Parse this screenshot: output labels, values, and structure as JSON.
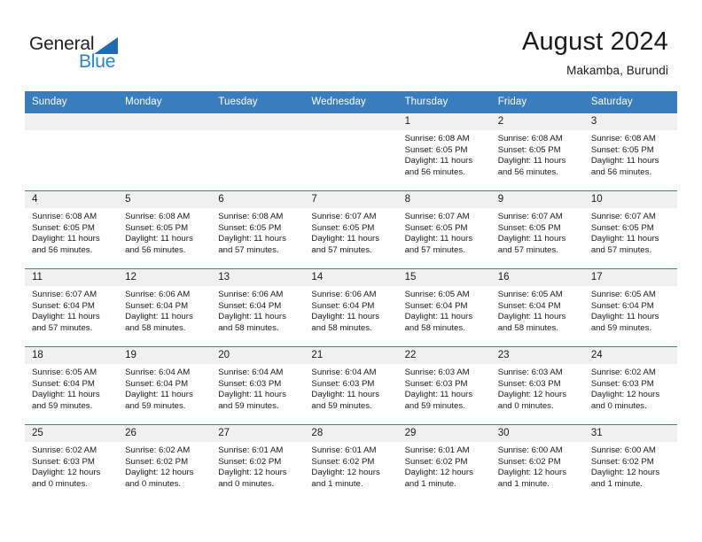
{
  "brand": {
    "name_part1": "General",
    "name_part2": "Blue",
    "triangle_color": "#1f6cb4",
    "blue_color": "#2684c8"
  },
  "header": {
    "title": "August 2024",
    "subtitle": "Makamba, Burundi"
  },
  "theme": {
    "header_row_bg": "#3a7dbf",
    "daynum_band_bg": "#f0f0f0",
    "cell_border": "#3a7dbf",
    "text": "#1a1a1a"
  },
  "weekday_headers": [
    "Sunday",
    "Monday",
    "Tuesday",
    "Wednesday",
    "Thursday",
    "Friday",
    "Saturday"
  ],
  "labels": {
    "sunrise_prefix": "Sunrise: ",
    "sunset_prefix": "Sunset: ",
    "daylight_prefix": "Daylight: "
  },
  "weeks": [
    [
      {
        "day": "",
        "sunrise": "",
        "sunset": "",
        "daylight": "",
        "empty": true
      },
      {
        "day": "",
        "sunrise": "",
        "sunset": "",
        "daylight": "",
        "empty": true
      },
      {
        "day": "",
        "sunrise": "",
        "sunset": "",
        "daylight": "",
        "empty": true
      },
      {
        "day": "",
        "sunrise": "",
        "sunset": "",
        "daylight": "",
        "empty": true
      },
      {
        "day": "1",
        "sunrise": "Sunrise: 6:08 AM",
        "sunset": "Sunset: 6:05 PM",
        "daylight": "Daylight: 11 hours and 56 minutes."
      },
      {
        "day": "2",
        "sunrise": "Sunrise: 6:08 AM",
        "sunset": "Sunset: 6:05 PM",
        "daylight": "Daylight: 11 hours and 56 minutes."
      },
      {
        "day": "3",
        "sunrise": "Sunrise: 6:08 AM",
        "sunset": "Sunset: 6:05 PM",
        "daylight": "Daylight: 11 hours and 56 minutes."
      }
    ],
    [
      {
        "day": "4",
        "sunrise": "Sunrise: 6:08 AM",
        "sunset": "Sunset: 6:05 PM",
        "daylight": "Daylight: 11 hours and 56 minutes."
      },
      {
        "day": "5",
        "sunrise": "Sunrise: 6:08 AM",
        "sunset": "Sunset: 6:05 PM",
        "daylight": "Daylight: 11 hours and 56 minutes."
      },
      {
        "day": "6",
        "sunrise": "Sunrise: 6:08 AM",
        "sunset": "Sunset: 6:05 PM",
        "daylight": "Daylight: 11 hours and 57 minutes."
      },
      {
        "day": "7",
        "sunrise": "Sunrise: 6:07 AM",
        "sunset": "Sunset: 6:05 PM",
        "daylight": "Daylight: 11 hours and 57 minutes."
      },
      {
        "day": "8",
        "sunrise": "Sunrise: 6:07 AM",
        "sunset": "Sunset: 6:05 PM",
        "daylight": "Daylight: 11 hours and 57 minutes."
      },
      {
        "day": "9",
        "sunrise": "Sunrise: 6:07 AM",
        "sunset": "Sunset: 6:05 PM",
        "daylight": "Daylight: 11 hours and 57 minutes."
      },
      {
        "day": "10",
        "sunrise": "Sunrise: 6:07 AM",
        "sunset": "Sunset: 6:05 PM",
        "daylight": "Daylight: 11 hours and 57 minutes."
      }
    ],
    [
      {
        "day": "11",
        "sunrise": "Sunrise: 6:07 AM",
        "sunset": "Sunset: 6:04 PM",
        "daylight": "Daylight: 11 hours and 57 minutes."
      },
      {
        "day": "12",
        "sunrise": "Sunrise: 6:06 AM",
        "sunset": "Sunset: 6:04 PM",
        "daylight": "Daylight: 11 hours and 58 minutes."
      },
      {
        "day": "13",
        "sunrise": "Sunrise: 6:06 AM",
        "sunset": "Sunset: 6:04 PM",
        "daylight": "Daylight: 11 hours and 58 minutes."
      },
      {
        "day": "14",
        "sunrise": "Sunrise: 6:06 AM",
        "sunset": "Sunset: 6:04 PM",
        "daylight": "Daylight: 11 hours and 58 minutes."
      },
      {
        "day": "15",
        "sunrise": "Sunrise: 6:05 AM",
        "sunset": "Sunset: 6:04 PM",
        "daylight": "Daylight: 11 hours and 58 minutes."
      },
      {
        "day": "16",
        "sunrise": "Sunrise: 6:05 AM",
        "sunset": "Sunset: 6:04 PM",
        "daylight": "Daylight: 11 hours and 58 minutes."
      },
      {
        "day": "17",
        "sunrise": "Sunrise: 6:05 AM",
        "sunset": "Sunset: 6:04 PM",
        "daylight": "Daylight: 11 hours and 59 minutes."
      }
    ],
    [
      {
        "day": "18",
        "sunrise": "Sunrise: 6:05 AM",
        "sunset": "Sunset: 6:04 PM",
        "daylight": "Daylight: 11 hours and 59 minutes."
      },
      {
        "day": "19",
        "sunrise": "Sunrise: 6:04 AM",
        "sunset": "Sunset: 6:04 PM",
        "daylight": "Daylight: 11 hours and 59 minutes."
      },
      {
        "day": "20",
        "sunrise": "Sunrise: 6:04 AM",
        "sunset": "Sunset: 6:03 PM",
        "daylight": "Daylight: 11 hours and 59 minutes."
      },
      {
        "day": "21",
        "sunrise": "Sunrise: 6:04 AM",
        "sunset": "Sunset: 6:03 PM",
        "daylight": "Daylight: 11 hours and 59 minutes."
      },
      {
        "day": "22",
        "sunrise": "Sunrise: 6:03 AM",
        "sunset": "Sunset: 6:03 PM",
        "daylight": "Daylight: 11 hours and 59 minutes."
      },
      {
        "day": "23",
        "sunrise": "Sunrise: 6:03 AM",
        "sunset": "Sunset: 6:03 PM",
        "daylight": "Daylight: 12 hours and 0 minutes."
      },
      {
        "day": "24",
        "sunrise": "Sunrise: 6:02 AM",
        "sunset": "Sunset: 6:03 PM",
        "daylight": "Daylight: 12 hours and 0 minutes."
      }
    ],
    [
      {
        "day": "25",
        "sunrise": "Sunrise: 6:02 AM",
        "sunset": "Sunset: 6:03 PM",
        "daylight": "Daylight: 12 hours and 0 minutes."
      },
      {
        "day": "26",
        "sunrise": "Sunrise: 6:02 AM",
        "sunset": "Sunset: 6:02 PM",
        "daylight": "Daylight: 12 hours and 0 minutes."
      },
      {
        "day": "27",
        "sunrise": "Sunrise: 6:01 AM",
        "sunset": "Sunset: 6:02 PM",
        "daylight": "Daylight: 12 hours and 0 minutes."
      },
      {
        "day": "28",
        "sunrise": "Sunrise: 6:01 AM",
        "sunset": "Sunset: 6:02 PM",
        "daylight": "Daylight: 12 hours and 1 minute."
      },
      {
        "day": "29",
        "sunrise": "Sunrise: 6:01 AM",
        "sunset": "Sunset: 6:02 PM",
        "daylight": "Daylight: 12 hours and 1 minute."
      },
      {
        "day": "30",
        "sunrise": "Sunrise: 6:00 AM",
        "sunset": "Sunset: 6:02 PM",
        "daylight": "Daylight: 12 hours and 1 minute."
      },
      {
        "day": "31",
        "sunrise": "Sunrise: 6:00 AM",
        "sunset": "Sunset: 6:02 PM",
        "daylight": "Daylight: 12 hours and 1 minute."
      }
    ]
  ]
}
